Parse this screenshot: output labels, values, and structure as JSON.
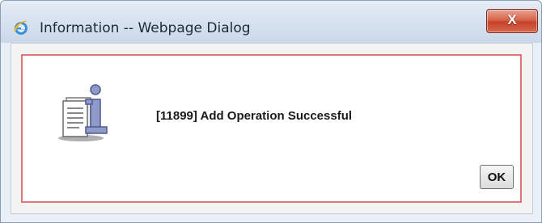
{
  "window": {
    "title": "Information -- Webpage Dialog",
    "close_label": "X",
    "close_button_color": "#d05a40"
  },
  "dialog": {
    "message": "[11899] Add Operation Successful",
    "ok_label": "OK",
    "border_color": "#e07777",
    "icon": "information-icon"
  }
}
